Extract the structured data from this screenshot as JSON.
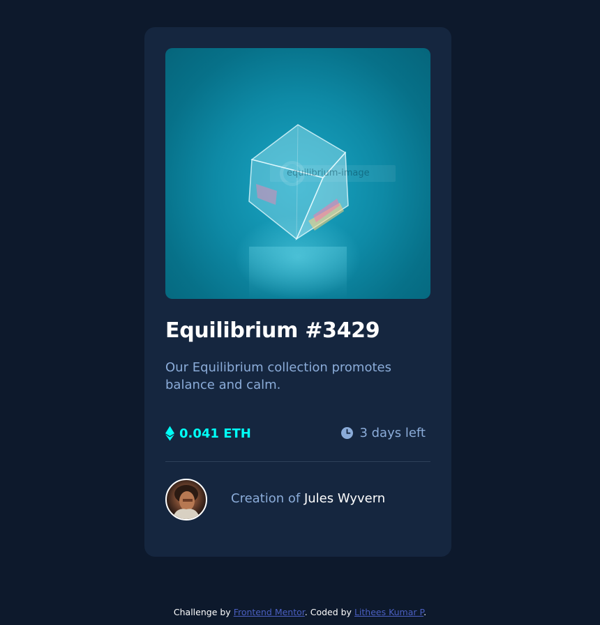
{
  "card": {
    "image_alt": "equilibrium-image",
    "title": "Equilibrium #3429",
    "description": "Our Equilibrium collection promotes balance and calm.",
    "price": "0.041 ETH",
    "price_icon": "ethereum-icon",
    "time_left": "3 days left",
    "time_icon": "clock-icon",
    "creator_prefix": "Creation of",
    "creator_name": "Jules Wyvern"
  },
  "footer": {
    "challenge_prefix": "Challenge by",
    "challenge_link": "Frontend Mentor",
    "coded_prefix": ". Coded by",
    "coded_link": "Lithees Kumar P",
    "end": "."
  },
  "colors": {
    "background": "#0d192c",
    "card": "#15263f",
    "accent_cyan": "#00fff7",
    "soft_blue": "#8bacd9",
    "link": "#4a5fc1"
  }
}
